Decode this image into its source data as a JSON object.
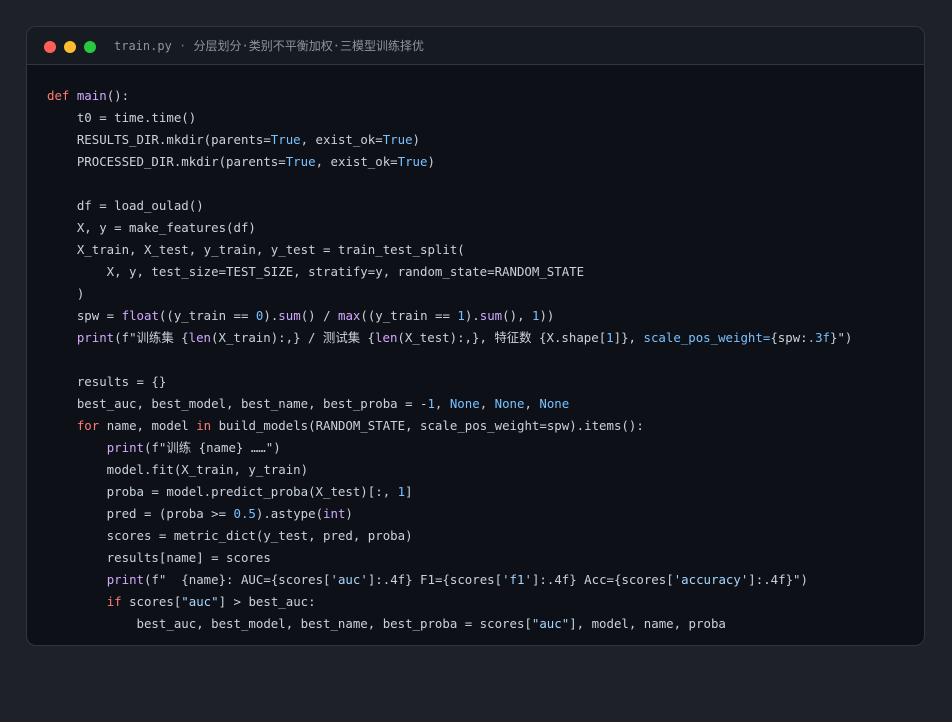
{
  "window": {
    "filename": "train.py",
    "separator": "·",
    "subtitle": "分层划分·类别不平衡加权·三模型训练择优"
  },
  "code_lines": [
    [
      {
        "t": "def ",
        "c": "kw"
      },
      {
        "t": "main",
        "c": "fn"
      },
      {
        "t": "():",
        "c": "plain"
      }
    ],
    [
      {
        "t": "    t0 = time.time()",
        "c": "plain"
      }
    ],
    [
      {
        "t": "    RESULTS_DIR.mkdir(parents=",
        "c": "plain"
      },
      {
        "t": "True",
        "c": "num"
      },
      {
        "t": ", exist_ok=",
        "c": "plain"
      },
      {
        "t": "True",
        "c": "num"
      },
      {
        "t": ")",
        "c": "plain"
      }
    ],
    [
      {
        "t": "    PROCESSED_DIR.mkdir(parents=",
        "c": "plain"
      },
      {
        "t": "True",
        "c": "num"
      },
      {
        "t": ", exist_ok=",
        "c": "plain"
      },
      {
        "t": "True",
        "c": "num"
      },
      {
        "t": ")",
        "c": "plain"
      }
    ],
    [],
    [
      {
        "t": "    df = load_oulad()",
        "c": "plain"
      }
    ],
    [
      {
        "t": "    X, y = make_features(df)",
        "c": "plain"
      }
    ],
    [
      {
        "t": "    X_train, X_test, y_train, y_test = train_test_split(",
        "c": "plain"
      }
    ],
    [
      {
        "t": "        X, y, test_size=TEST_SIZE, stratify=y, random_state=RANDOM_STATE",
        "c": "plain"
      }
    ],
    [
      {
        "t": "    )",
        "c": "plain"
      }
    ],
    [
      {
        "t": "    spw = ",
        "c": "plain"
      },
      {
        "t": "float",
        "c": "bi"
      },
      {
        "t": "((y_train == ",
        "c": "plain"
      },
      {
        "t": "0",
        "c": "num"
      },
      {
        "t": ").",
        "c": "plain"
      },
      {
        "t": "sum",
        "c": "bi"
      },
      {
        "t": "() / ",
        "c": "plain"
      },
      {
        "t": "max",
        "c": "bi"
      },
      {
        "t": "((y_train == ",
        "c": "plain"
      },
      {
        "t": "1",
        "c": "num"
      },
      {
        "t": ").",
        "c": "plain"
      },
      {
        "t": "sum",
        "c": "bi"
      },
      {
        "t": "(), ",
        "c": "plain"
      },
      {
        "t": "1",
        "c": "num"
      },
      {
        "t": "))",
        "c": "plain"
      }
    ],
    [
      {
        "t": "    ",
        "c": "plain"
      },
      {
        "t": "print",
        "c": "bi"
      },
      {
        "t": "(f\"训练集 {",
        "c": "plain"
      },
      {
        "t": "len",
        "c": "bi"
      },
      {
        "t": "(X_train):,} / 测试集 {",
        "c": "plain"
      },
      {
        "t": "len",
        "c": "bi"
      },
      {
        "t": "(X_test):,}, 特征数 {X.shape[",
        "c": "plain"
      },
      {
        "t": "1",
        "c": "num"
      },
      {
        "t": "]}, ",
        "c": "plain"
      },
      {
        "t": "scale_pos_weight=",
        "c": "num"
      },
      {
        "t": "{spw:",
        "c": "plain"
      },
      {
        "t": ".3f",
        "c": "num"
      },
      {
        "t": "}\")",
        "c": "plain"
      }
    ],
    [],
    [
      {
        "t": "    results = {}",
        "c": "plain"
      }
    ],
    [
      {
        "t": "    best_auc, best_model, best_name, best_proba = -",
        "c": "plain"
      },
      {
        "t": "1",
        "c": "num"
      },
      {
        "t": ", ",
        "c": "plain"
      },
      {
        "t": "None",
        "c": "num"
      },
      {
        "t": ", ",
        "c": "plain"
      },
      {
        "t": "None",
        "c": "num"
      },
      {
        "t": ", ",
        "c": "plain"
      },
      {
        "t": "None",
        "c": "num"
      }
    ],
    [
      {
        "t": "    ",
        "c": "plain"
      },
      {
        "t": "for",
        "c": "kw"
      },
      {
        "t": " name, model ",
        "c": "plain"
      },
      {
        "t": "in",
        "c": "kw"
      },
      {
        "t": " build_models(RANDOM_STATE, scale_pos_weight=spw).items():",
        "c": "plain"
      }
    ],
    [
      {
        "t": "        ",
        "c": "plain"
      },
      {
        "t": "print",
        "c": "bi"
      },
      {
        "t": "(f\"训练 {name} ……\")",
        "c": "plain"
      }
    ],
    [
      {
        "t": "        model.fit(X_train, y_train)",
        "c": "plain"
      }
    ],
    [
      {
        "t": "        proba = model.predict_proba(X_test)[:, ",
        "c": "plain"
      },
      {
        "t": "1",
        "c": "num"
      },
      {
        "t": "]",
        "c": "plain"
      }
    ],
    [
      {
        "t": "        pred = (proba >= ",
        "c": "plain"
      },
      {
        "t": "0.5",
        "c": "num"
      },
      {
        "t": ").astype(",
        "c": "plain"
      },
      {
        "t": "int",
        "c": "bi"
      },
      {
        "t": ")",
        "c": "plain"
      }
    ],
    [
      {
        "t": "        scores = metric_dict(y_test, pred, proba)",
        "c": "plain"
      }
    ],
    [
      {
        "t": "        results[name] = scores",
        "c": "plain"
      }
    ],
    [
      {
        "t": "        ",
        "c": "plain"
      },
      {
        "t": "print",
        "c": "bi"
      },
      {
        "t": "(f\"  {name}: AUC={scores[",
        "c": "plain"
      },
      {
        "t": "'auc'",
        "c": "str"
      },
      {
        "t": "]:.4f} F1={scores[",
        "c": "plain"
      },
      {
        "t": "'f1'",
        "c": "str"
      },
      {
        "t": "]:.4f} Acc={scores[",
        "c": "plain"
      },
      {
        "t": "'accuracy'",
        "c": "str"
      },
      {
        "t": "]:.4f}\")",
        "c": "plain"
      }
    ],
    [
      {
        "t": "        ",
        "c": "plain"
      },
      {
        "t": "if",
        "c": "kw"
      },
      {
        "t": " scores[",
        "c": "plain"
      },
      {
        "t": "\"auc\"",
        "c": "str"
      },
      {
        "t": "] > best_auc:",
        "c": "plain"
      }
    ],
    [
      {
        "t": "            best_auc, best_model, best_name, best_proba = scores[",
        "c": "plain"
      },
      {
        "t": "\"auc\"",
        "c": "str"
      },
      {
        "t": "], model, name, proba",
        "c": "plain"
      }
    ]
  ]
}
